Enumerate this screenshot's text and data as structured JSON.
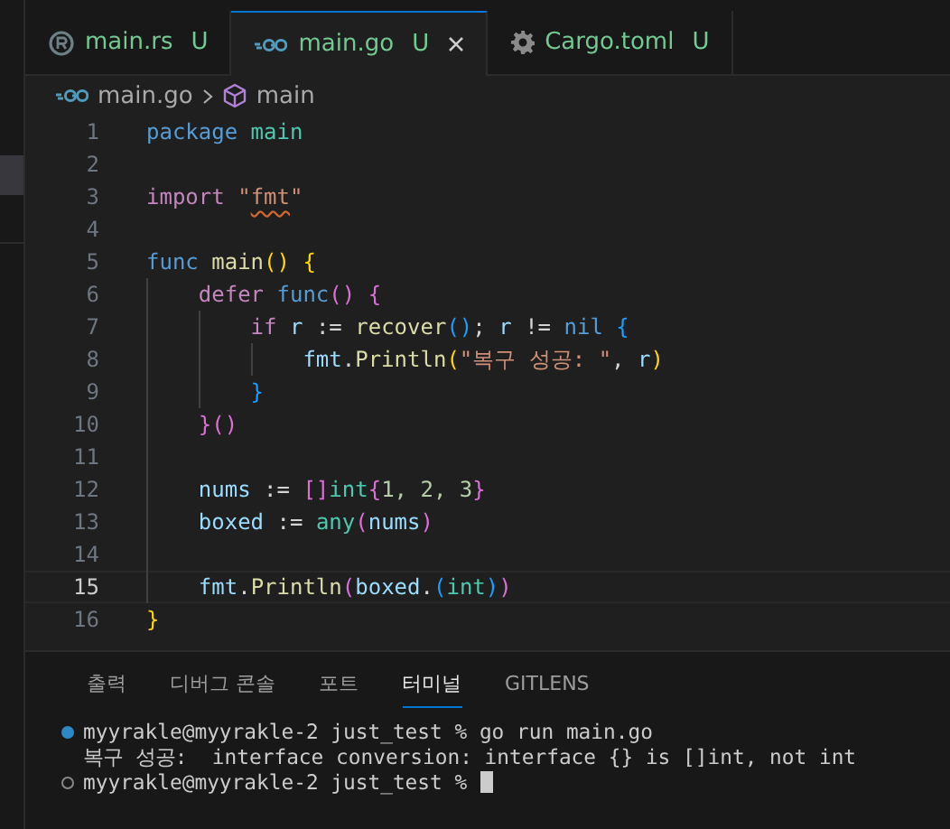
{
  "tabs": [
    {
      "label": "main.rs",
      "kind": "rust",
      "status": "U",
      "selected": false
    },
    {
      "label": "main.go",
      "kind": "go",
      "status": "U",
      "selected": true
    },
    {
      "label": "Cargo.toml",
      "kind": "toml",
      "status": "U",
      "selected": false
    }
  ],
  "breadcrumb": [
    {
      "label": "main.go",
      "kind": "file"
    },
    {
      "label": "main",
      "kind": "module"
    }
  ],
  "editor": {
    "lines": [
      {
        "number": "1",
        "current": false,
        "tokens": [
          {
            "text": "package ",
            "kind": "kw"
          },
          {
            "text": "main",
            "kind": "type"
          }
        ]
      },
      {
        "number": "2",
        "current": false
      },
      {
        "number": "3",
        "current": false,
        "tokens": [
          {
            "text": "import ",
            "kind": "ctl"
          },
          {
            "text": "\"",
            "kind": "str"
          },
          {
            "text": "fmt",
            "kind": "flagged"
          },
          {
            "text": "\"",
            "kind": "str"
          }
        ]
      },
      {
        "number": "4",
        "current": false
      },
      {
        "number": "5",
        "current": false,
        "tokens": [
          {
            "text": "func ",
            "kind": "kw"
          },
          {
            "text": "main",
            "kind": "fn"
          },
          {
            "text": "() {",
            "kind": "b1"
          }
        ]
      },
      {
        "number": "6",
        "current": false,
        "tokens": [
          {
            "text": "    defer ",
            "kind": "ctl"
          },
          {
            "text": "func",
            "kind": "kw"
          },
          {
            "text": "() {",
            "kind": "b2"
          }
        ]
      },
      {
        "number": "7",
        "current": false,
        "tokens": [
          {
            "text": "        if ",
            "kind": "ctl"
          },
          {
            "text": "r",
            "kind": "var"
          },
          {
            "text": " := ",
            "kind": "plain"
          },
          {
            "text": "recover",
            "kind": "fn"
          },
          {
            "text": "()",
            "kind": "b3"
          },
          {
            "text": "; ",
            "kind": "plain"
          },
          {
            "text": "r",
            "kind": "var"
          },
          {
            "text": " != ",
            "kind": "plain"
          },
          {
            "text": "nil ",
            "kind": "kw"
          },
          {
            "text": "{",
            "kind": "b3"
          }
        ]
      },
      {
        "number": "8",
        "current": false,
        "tokens": [
          {
            "text": "            fmt",
            "kind": "var"
          },
          {
            "text": ".",
            "kind": "plain"
          },
          {
            "text": "Println",
            "kind": "fn"
          },
          {
            "text": "(",
            "kind": "b1"
          },
          {
            "text": "\"복구 성공: \"",
            "kind": "str"
          },
          {
            "text": ", ",
            "kind": "plain"
          },
          {
            "text": "r",
            "kind": "var"
          },
          {
            "text": ")",
            "kind": "b1"
          }
        ]
      },
      {
        "number": "9",
        "current": false,
        "tokens": [
          {
            "text": "        }",
            "kind": "b3"
          }
        ]
      },
      {
        "number": "10",
        "current": false,
        "tokens": [
          {
            "text": "    }()",
            "kind": "b2"
          }
        ]
      },
      {
        "number": "11",
        "current": false
      },
      {
        "number": "12",
        "current": false,
        "tokens": [
          {
            "text": "    nums",
            "kind": "var"
          },
          {
            "text": " := ",
            "kind": "plain"
          },
          {
            "text": "[]",
            "kind": "b2"
          },
          {
            "text": "int",
            "kind": "type"
          },
          {
            "text": "{",
            "kind": "b2"
          },
          {
            "text": "1, 2, 3",
            "kind": "num"
          },
          {
            "text": "}",
            "kind": "b2"
          }
        ]
      },
      {
        "number": "13",
        "current": false,
        "tokens": [
          {
            "text": "    boxed",
            "kind": "var"
          },
          {
            "text": " := ",
            "kind": "plain"
          },
          {
            "text": "any",
            "kind": "type"
          },
          {
            "text": "(",
            "kind": "b2"
          },
          {
            "text": "nums",
            "kind": "var"
          },
          {
            "text": ")",
            "kind": "b2"
          }
        ]
      },
      {
        "number": "14",
        "current": false
      },
      {
        "number": "15",
        "current": true,
        "tokens": [
          {
            "text": "    fmt",
            "kind": "var"
          },
          {
            "text": ".",
            "kind": "plain"
          },
          {
            "text": "Println",
            "kind": "fn"
          },
          {
            "text": "(",
            "kind": "b2"
          },
          {
            "text": "boxed",
            "kind": "var"
          },
          {
            "text": ".",
            "kind": "plain"
          },
          {
            "text": "(",
            "kind": "b3"
          },
          {
            "text": "int",
            "kind": "type"
          },
          {
            "text": ")",
            "kind": "b3"
          },
          {
            "text": ")",
            "kind": "b2"
          }
        ]
      },
      {
        "number": "16",
        "current": false,
        "tokens": [
          {
            "text": "}",
            "kind": "b1"
          }
        ]
      }
    ]
  },
  "panel": {
    "tabs": [
      {
        "label": "출력",
        "selected": false
      },
      {
        "label": "디버그 콘솔",
        "selected": false
      },
      {
        "label": "포트",
        "selected": false
      },
      {
        "label": "터미널",
        "selected": true
      },
      {
        "label": "GITLENS",
        "selected": false
      }
    ],
    "terminal": [
      {
        "kind": "command_done",
        "text": "myyrakle@myyrakle-2 just_test % go run main.go"
      },
      {
        "kind": "output",
        "text": "복구 성공:  interface conversion: interface {} is []int, not int"
      },
      {
        "kind": "prompt",
        "text": "myyrakle@myyrakle-2 just_test %"
      }
    ]
  }
}
